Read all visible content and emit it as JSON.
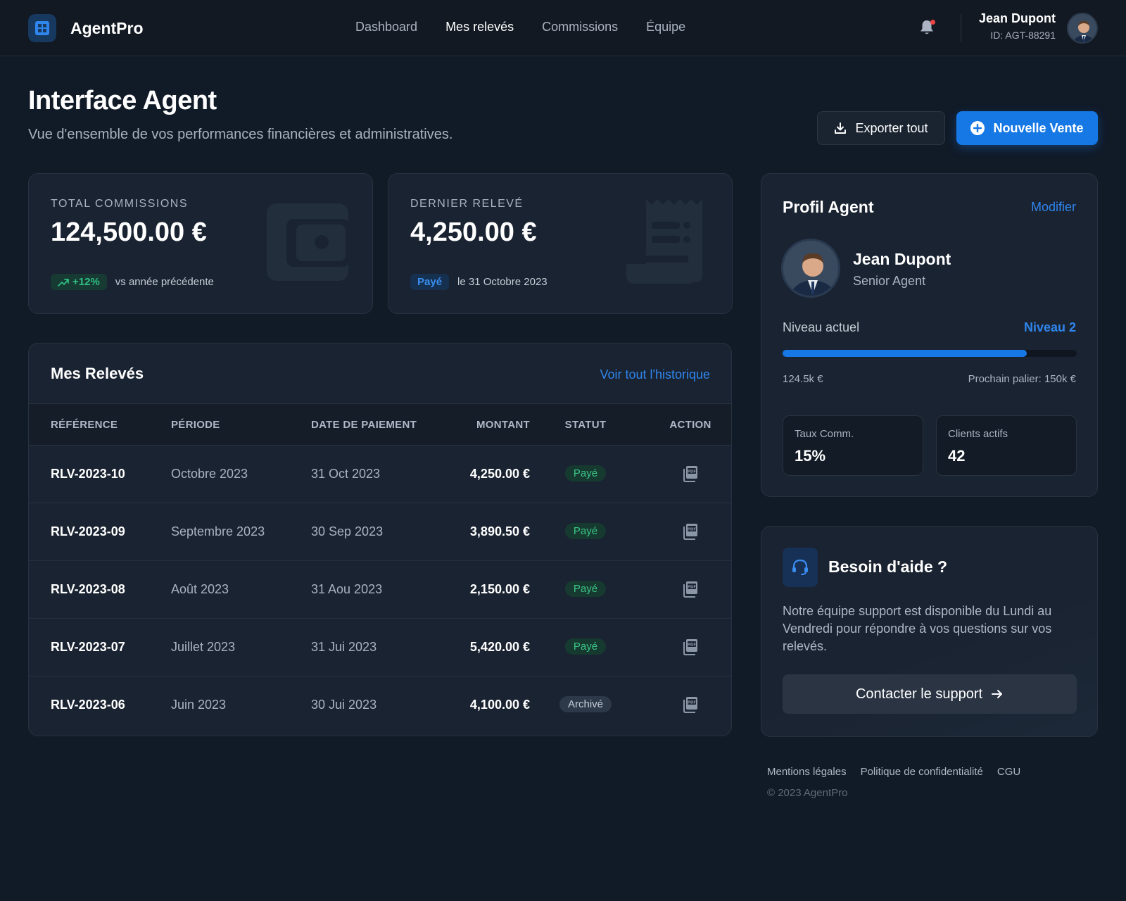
{
  "brand": {
    "name": "AgentPro",
    "logo_icon": "grid-icon",
    "accent": "#1678e5"
  },
  "nav": {
    "items": [
      {
        "label": "Dashboard",
        "active": false
      },
      {
        "label": "Mes relevés",
        "active": true
      },
      {
        "label": "Commissions",
        "active": false
      },
      {
        "label": "Équipe",
        "active": false
      }
    ]
  },
  "user": {
    "name": "Jean Dupont",
    "id": "ID: AGT-88291"
  },
  "header": {
    "title": "Interface Agent",
    "subtitle": "Vue d'ensemble de vos performances financières et administratives.",
    "export_label": "Exporter tout",
    "new_sale_label": "Nouvelle Vente"
  },
  "stats": {
    "total": {
      "label": "TOTAL COMMISSIONS",
      "value": "124,500.00 €",
      "trend": "+12%",
      "trend_note": "vs année précédente"
    },
    "last": {
      "label": "DERNIER RELEVÉ",
      "value": "4,250.00 €",
      "badge": "Payé",
      "note": "le 31 Octobre 2023"
    }
  },
  "statements": {
    "title": "Mes Relevés",
    "history_link": "Voir tout l'historique",
    "columns": [
      "RÉFÉRENCE",
      "PÉRIODE",
      "DATE DE PAIEMENT",
      "MONTANT",
      "STATUT",
      "ACTION"
    ],
    "rows": [
      {
        "ref": "RLV-2023-10",
        "period": "Octobre 2023",
        "date": "31 Oct 2023",
        "amount": "4,250.00 €",
        "status": "Payé",
        "status_type": "paid"
      },
      {
        "ref": "RLV-2023-09",
        "period": "Septembre 2023",
        "date": "30 Sep 2023",
        "amount": "3,890.50 €",
        "status": "Payé",
        "status_type": "paid"
      },
      {
        "ref": "RLV-2023-08",
        "period": "Août 2023",
        "date": "31 Aou 2023",
        "amount": "2,150.00 €",
        "status": "Payé",
        "status_type": "paid"
      },
      {
        "ref": "RLV-2023-07",
        "period": "Juillet 2023",
        "date": "31 Jui 2023",
        "amount": "5,420.00 €",
        "status": "Payé",
        "status_type": "paid"
      },
      {
        "ref": "RLV-2023-06",
        "period": "Juin 2023",
        "date": "30 Jui 2023",
        "amount": "4,100.00 €",
        "status": "Archivé",
        "status_type": "archived"
      }
    ]
  },
  "profile": {
    "title": "Profil Agent",
    "edit_label": "Modifier",
    "name": "Jean Dupont",
    "role": "Senior Agent",
    "level_label": "Niveau actuel",
    "level_value": "Niveau 2",
    "progress_fraction": 0.83,
    "current_amount": "124.5k €",
    "next_tier": "Prochain palier: 150k €",
    "rate_label": "Taux Comm.",
    "rate_value": "15%",
    "clients_label": "Clients actifs",
    "clients_value": "42"
  },
  "help": {
    "title": "Besoin d'aide ?",
    "text": "Notre équipe support est disponible du Lundi au Vendredi pour répondre à vos questions sur vos relevés.",
    "button_label": "Contacter le support"
  },
  "footer": {
    "links": [
      "Mentions légales",
      "Politique de confidentialité",
      "CGU"
    ],
    "copyright": "© 2023 AgentPro"
  }
}
